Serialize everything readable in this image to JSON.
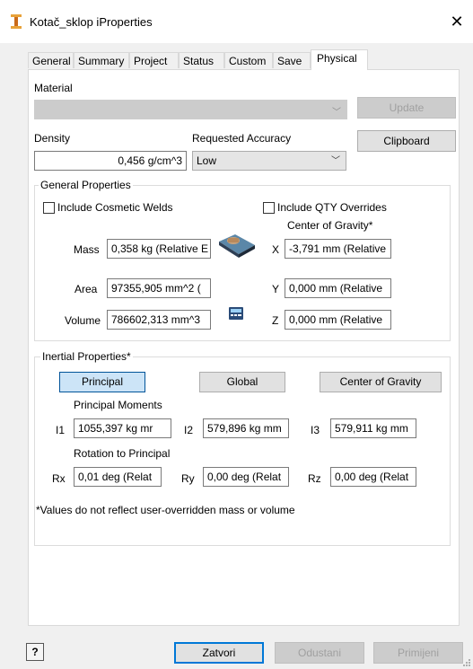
{
  "window": {
    "title": "Kotač_sklop iProperties",
    "close_glyph": "✕"
  },
  "tabs": [
    "General",
    "Summary",
    "Project",
    "Status",
    "Custom",
    "Save",
    "Physical"
  ],
  "material": {
    "label": "Material",
    "value": "",
    "update_button": "Update"
  },
  "density": {
    "label": "Density",
    "value": "0,456 g/cm^3"
  },
  "accuracy": {
    "label": "Requested Accuracy",
    "value": "Low"
  },
  "clipboard_button": "Clipboard",
  "general_properties": {
    "title": "General Properties",
    "cosmetic_welds": {
      "label": "Include Cosmetic Welds",
      "checked": false
    },
    "qty_overrides": {
      "label": "Include QTY Overrides",
      "checked": false
    },
    "center_of_gravity_label": "Center of Gravity*",
    "mass": {
      "label": "Mass",
      "value": "0,358 kg (Relative E"
    },
    "area": {
      "label": "Area",
      "value": "97355,905 mm^2 ("
    },
    "volume": {
      "label": "Volume",
      "value": "786602,313 mm^3"
    },
    "x": {
      "label": "X",
      "value": "-3,791 mm (Relative"
    },
    "y": {
      "label": "Y",
      "value": "0,000 mm (Relative"
    },
    "z": {
      "label": "Z",
      "value": "0,000 mm (Relative"
    }
  },
  "inertial_properties": {
    "title": "Inertial Properties*",
    "buttons": {
      "principal": "Principal",
      "global": "Global",
      "center_of_gravity": "Center of Gravity"
    },
    "principal_moments_label": "Principal Moments",
    "i1": {
      "label": "I1",
      "value": "1055,397 kg mr"
    },
    "i2": {
      "label": "I2",
      "value": "579,896 kg mm"
    },
    "i3": {
      "label": "I3",
      "value": "579,911 kg mm"
    },
    "rotation_label": "Rotation to Principal",
    "rx": {
      "label": "Rx",
      "value": "0,01 deg (Relat"
    },
    "ry": {
      "label": "Ry",
      "value": "0,00 deg (Relat"
    },
    "rz": {
      "label": "Rz",
      "value": "0,00 deg (Relat"
    },
    "note": "*Values do not reflect user-overridden mass or volume"
  },
  "footer": {
    "help_glyph": "?",
    "close": "Zatvori",
    "cancel": "Odustani",
    "apply": "Primijeni"
  },
  "colors": {
    "accent": "#0078d7",
    "panel": "#ffffff",
    "background": "#f0f0f0"
  }
}
